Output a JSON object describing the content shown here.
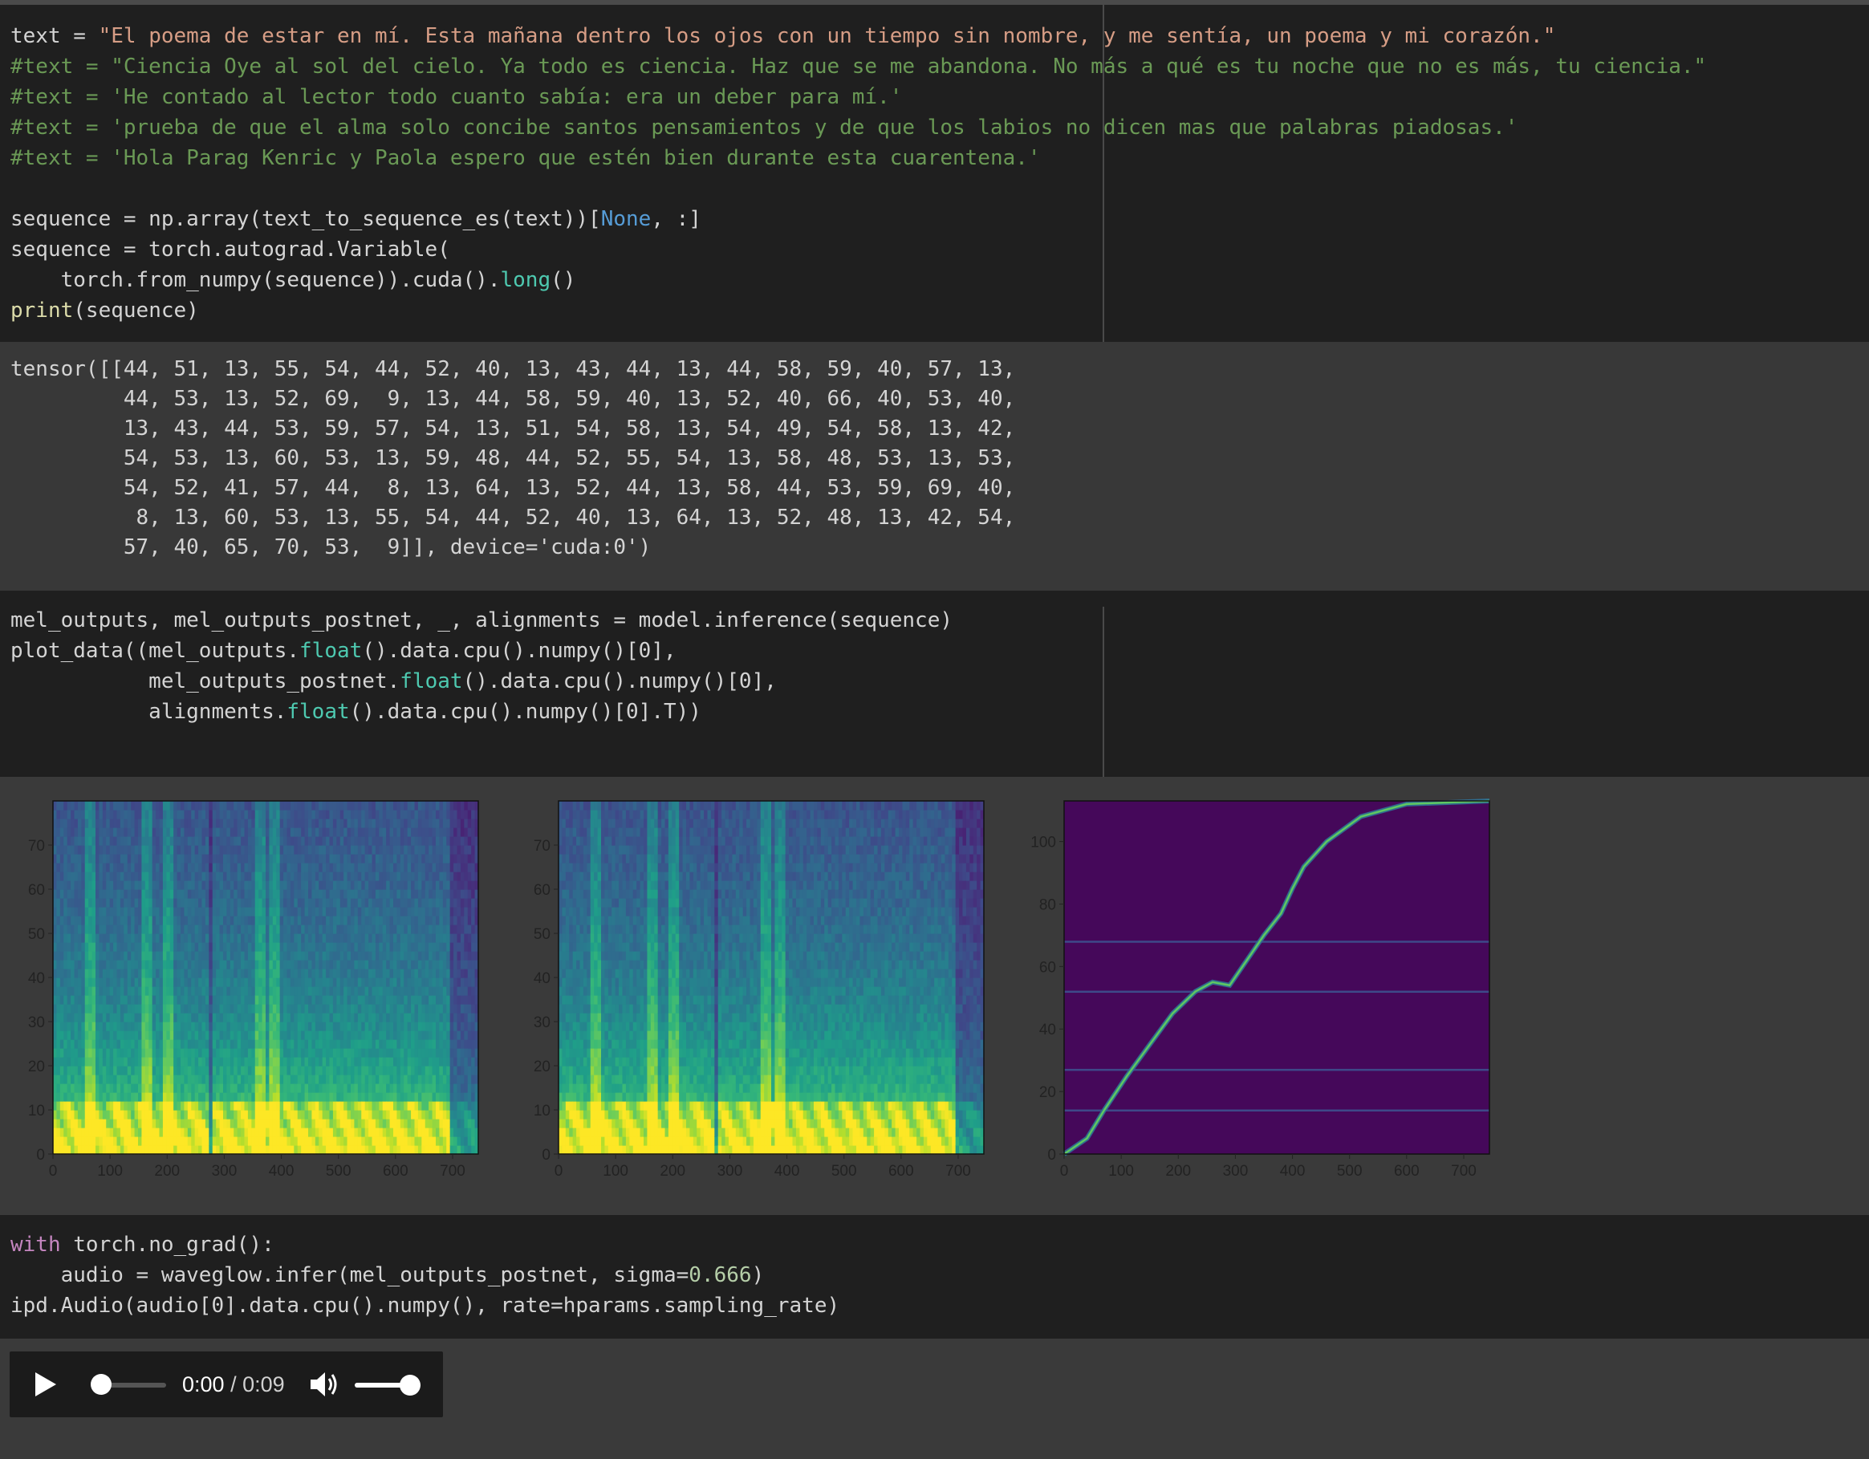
{
  "cells": {
    "cell1": {
      "lines": [
        [
          {
            "t": "text = ",
            "c": ""
          },
          {
            "t": "\"El poema de estar en mí. Esta mañana dentro los ojos con un tiempo sin nombre, y me sentía, un poema y mi corazón.\"",
            "c": "str"
          }
        ],
        [
          {
            "t": "#text = \"Ciencia Oye al sol del cielo. Ya todo es ciencia. Haz que se me abandona. No más a qué es tu noche que no es más, tu ciencia.\"",
            "c": "com"
          }
        ],
        [
          {
            "t": "#text = 'He contado al lector todo cuanto sabía: era un deber para mí.'",
            "c": "com"
          }
        ],
        [
          {
            "t": "#text = 'prueba de que el alma solo concibe santos pensamientos y de que los labios no dicen mas que palabras piadosas.'",
            "c": "com"
          }
        ],
        [
          {
            "t": "#text = 'Hola Parag Kenric y Paola espero que estén bien durante esta cuarentena.'",
            "c": "com"
          }
        ],
        [
          {
            "t": "",
            "c": ""
          }
        ],
        [
          {
            "t": "sequence = np.array(text_to_sequence_es(text))[",
            "c": ""
          },
          {
            "t": "None",
            "c": "bl"
          },
          {
            "t": ", :]",
            "c": ""
          }
        ],
        [
          {
            "t": "sequence = torch.autograd.Variable(",
            "c": ""
          }
        ],
        [
          {
            "t": "    torch.from_numpy(sequence)).cuda().",
            "c": ""
          },
          {
            "t": "long",
            "c": "at"
          },
          {
            "t": "()",
            "c": ""
          }
        ],
        [
          {
            "t": "print",
            "c": "fn"
          },
          {
            "t": "(sequence)",
            "c": ""
          }
        ]
      ]
    },
    "out1": {
      "lines": [
        "tensor([[44, 51, 13, 55, 54, 44, 52, 40, 13, 43, 44, 13, 44, 58, 59, 40, 57, 13,",
        "         44, 53, 13, 52, 69,  9, 13, 44, 58, 59, 40, 13, 52, 40, 66, 40, 53, 40,",
        "         13, 43, 44, 53, 59, 57, 54, 13, 51, 54, 58, 13, 54, 49, 54, 58, 13, 42,",
        "         54, 53, 13, 60, 53, 13, 59, 48, 44, 52, 55, 54, 13, 58, 48, 53, 13, 53,",
        "         54, 52, 41, 57, 44,  8, 13, 64, 13, 52, 44, 13, 58, 44, 53, 59, 69, 40,",
        "          8, 13, 60, 53, 13, 55, 54, 44, 52, 40, 13, 64, 13, 52, 48, 13, 42, 54,",
        "         57, 40, 65, 70, 53,  9]], device='cuda:0')"
      ]
    },
    "cell2": {
      "lines": [
        [
          {
            "t": "mel_outputs, mel_outputs_postnet, _, alignments = model.inference(sequence)",
            "c": ""
          }
        ],
        [
          {
            "t": "plot_data((mel_outputs.",
            "c": ""
          },
          {
            "t": "float",
            "c": "at"
          },
          {
            "t": "().data.cpu().numpy()[0],",
            "c": ""
          }
        ],
        [
          {
            "t": "           mel_outputs_postnet.",
            "c": ""
          },
          {
            "t": "float",
            "c": "at"
          },
          {
            "t": "().data.cpu().numpy()[0],",
            "c": ""
          }
        ],
        [
          {
            "t": "           alignments.",
            "c": ""
          },
          {
            "t": "float",
            "c": "at"
          },
          {
            "t": "().data.cpu().numpy()[0].T))",
            "c": ""
          }
        ]
      ]
    },
    "cell3": {
      "lines": [
        [
          {
            "t": "with",
            "c": "kw"
          },
          {
            "t": " torch.no_grad():",
            "c": ""
          }
        ],
        [
          {
            "t": "    audio = waveglow.infer(mel_outputs_postnet, sigma=",
            "c": ""
          },
          {
            "t": "0.666",
            "c": "num"
          },
          {
            "t": ")",
            "c": ""
          }
        ],
        [
          {
            "t": "ipd.Audio(audio[0].data.cpu().numpy(), rate=hparams.sampling_rate)",
            "c": ""
          }
        ]
      ]
    }
  },
  "chart_data": [
    {
      "type": "heatmap",
      "title": "",
      "xlabel": "",
      "ylabel": "",
      "xlim": [
        0,
        745
      ],
      "ylim": [
        0,
        80
      ],
      "xticks": [
        0,
        100,
        200,
        300,
        400,
        500,
        600,
        700
      ],
      "yticks": [
        0,
        10,
        20,
        30,
        40,
        50,
        60,
        70
      ],
      "colormap": "viridis",
      "content": "mel spectrogram (decoder output)"
    },
    {
      "type": "heatmap",
      "title": "",
      "xlabel": "",
      "ylabel": "",
      "xlim": [
        0,
        745
      ],
      "ylim": [
        0,
        80
      ],
      "xticks": [
        0,
        100,
        200,
        300,
        400,
        500,
        600,
        700
      ],
      "yticks": [
        0,
        10,
        20,
        30,
        40,
        50,
        60,
        70
      ],
      "colormap": "viridis",
      "content": "mel spectrogram (postnet output)"
    },
    {
      "type": "heatmap",
      "title": "",
      "xlabel": "",
      "ylabel": "",
      "xlim": [
        0,
        745
      ],
      "ylim": [
        0,
        113
      ],
      "xticks": [
        0,
        100,
        200,
        300,
        400,
        500,
        600,
        700
      ],
      "yticks": [
        0,
        20,
        40,
        60,
        80,
        100
      ],
      "colormap": "viridis",
      "content": "attention alignment",
      "alignment_path": [
        [
          0,
          0
        ],
        [
          40,
          5
        ],
        [
          70,
          14
        ],
        [
          110,
          25
        ],
        [
          150,
          35
        ],
        [
          190,
          45
        ],
        [
          230,
          52
        ],
        [
          260,
          55
        ],
        [
          290,
          54
        ],
        [
          320,
          62
        ],
        [
          350,
          70
        ],
        [
          380,
          77
        ],
        [
          400,
          85
        ],
        [
          420,
          92
        ],
        [
          460,
          100
        ],
        [
          520,
          108
        ],
        [
          600,
          112
        ],
        [
          745,
          113
        ]
      ]
    }
  ],
  "player": {
    "current_time": "0:00",
    "separator": "/",
    "duration": "0:09",
    "progress": 0.0,
    "volume": 1.0
  }
}
